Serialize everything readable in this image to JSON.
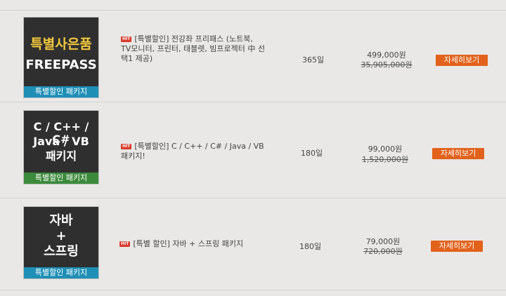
{
  "rows": [
    {
      "thumb_line1": "특별사은품",
      "thumb_line2": "FREEPASS",
      "tag": "특별할인 패키지",
      "hit": "HIT",
      "desc_line1": "[특별할인] 전강좌 프리패스 (노트북,",
      "desc_line2": "TV모니터, 프린터, 태블렛, 빔프로젝터 中 선",
      "desc_line3": "택1 제공)",
      "period": "365일",
      "price": "499,000원",
      "original_price": "35,905,000원",
      "button": "자세히보기"
    },
    {
      "thumb_line1": "C / C++ / C#",
      "thumb_line2": "Java / VB",
      "thumb_line3": "패키지",
      "tag": "특별할인 패키지",
      "hit": "HIT",
      "desc_line1": "[특별할인] C / C++ / C# / Java / VB",
      "desc_line2": "패키지!",
      "period": "180일",
      "price": "99,000원",
      "original_price": "1,520,000원",
      "button": "자세히보기"
    },
    {
      "thumb_line1": "자바",
      "thumb_line2": "+",
      "thumb_line3": "스프링",
      "tag": "특별할인 패키지",
      "hit": "HIT",
      "desc_line1": "[특별 할인] 자바 + 스프링 패키지",
      "period": "180일",
      "price": "79,000원",
      "original_price": "720,000원",
      "button": "자세히보기"
    }
  ],
  "colors": {
    "button": "#e2621b",
    "hit_badge": "#d93a2b",
    "tag_blue": "#1f8fb6",
    "tag_green": "#3c8a3c",
    "thumb_bg": "#2f2f30"
  },
  "icons": {
    "hit": "hit-badge-icon"
  }
}
